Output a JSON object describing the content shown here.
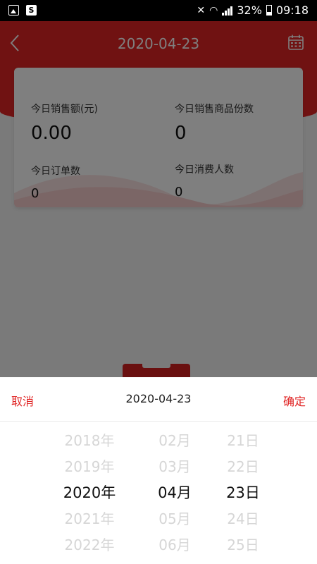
{
  "status_bar": {
    "battery": "32%",
    "time": "09:18"
  },
  "header": {
    "title": "2020-04-23"
  },
  "stats": {
    "sales_amount_label": "今日销售额(元)",
    "sales_amount_value": "0.00",
    "items_sold_label": "今日销售商品份数",
    "items_sold_value": "0",
    "orders_label": "今日订单数",
    "orders_value": "0",
    "customers_label": "今日消费人数",
    "customers_value": "0"
  },
  "picker": {
    "cancel_label": "取消",
    "title": "2020-04-23",
    "confirm_label": "确定",
    "years": [
      "2018年",
      "2019年",
      "2020年",
      "2021年",
      "2022年"
    ],
    "months": [
      "02月",
      "03月",
      "04月",
      "05月",
      "06月"
    ],
    "days": [
      "21日",
      "22日",
      "23日",
      "24日",
      "25日"
    ]
  },
  "colors": {
    "accent": "#e02525"
  }
}
